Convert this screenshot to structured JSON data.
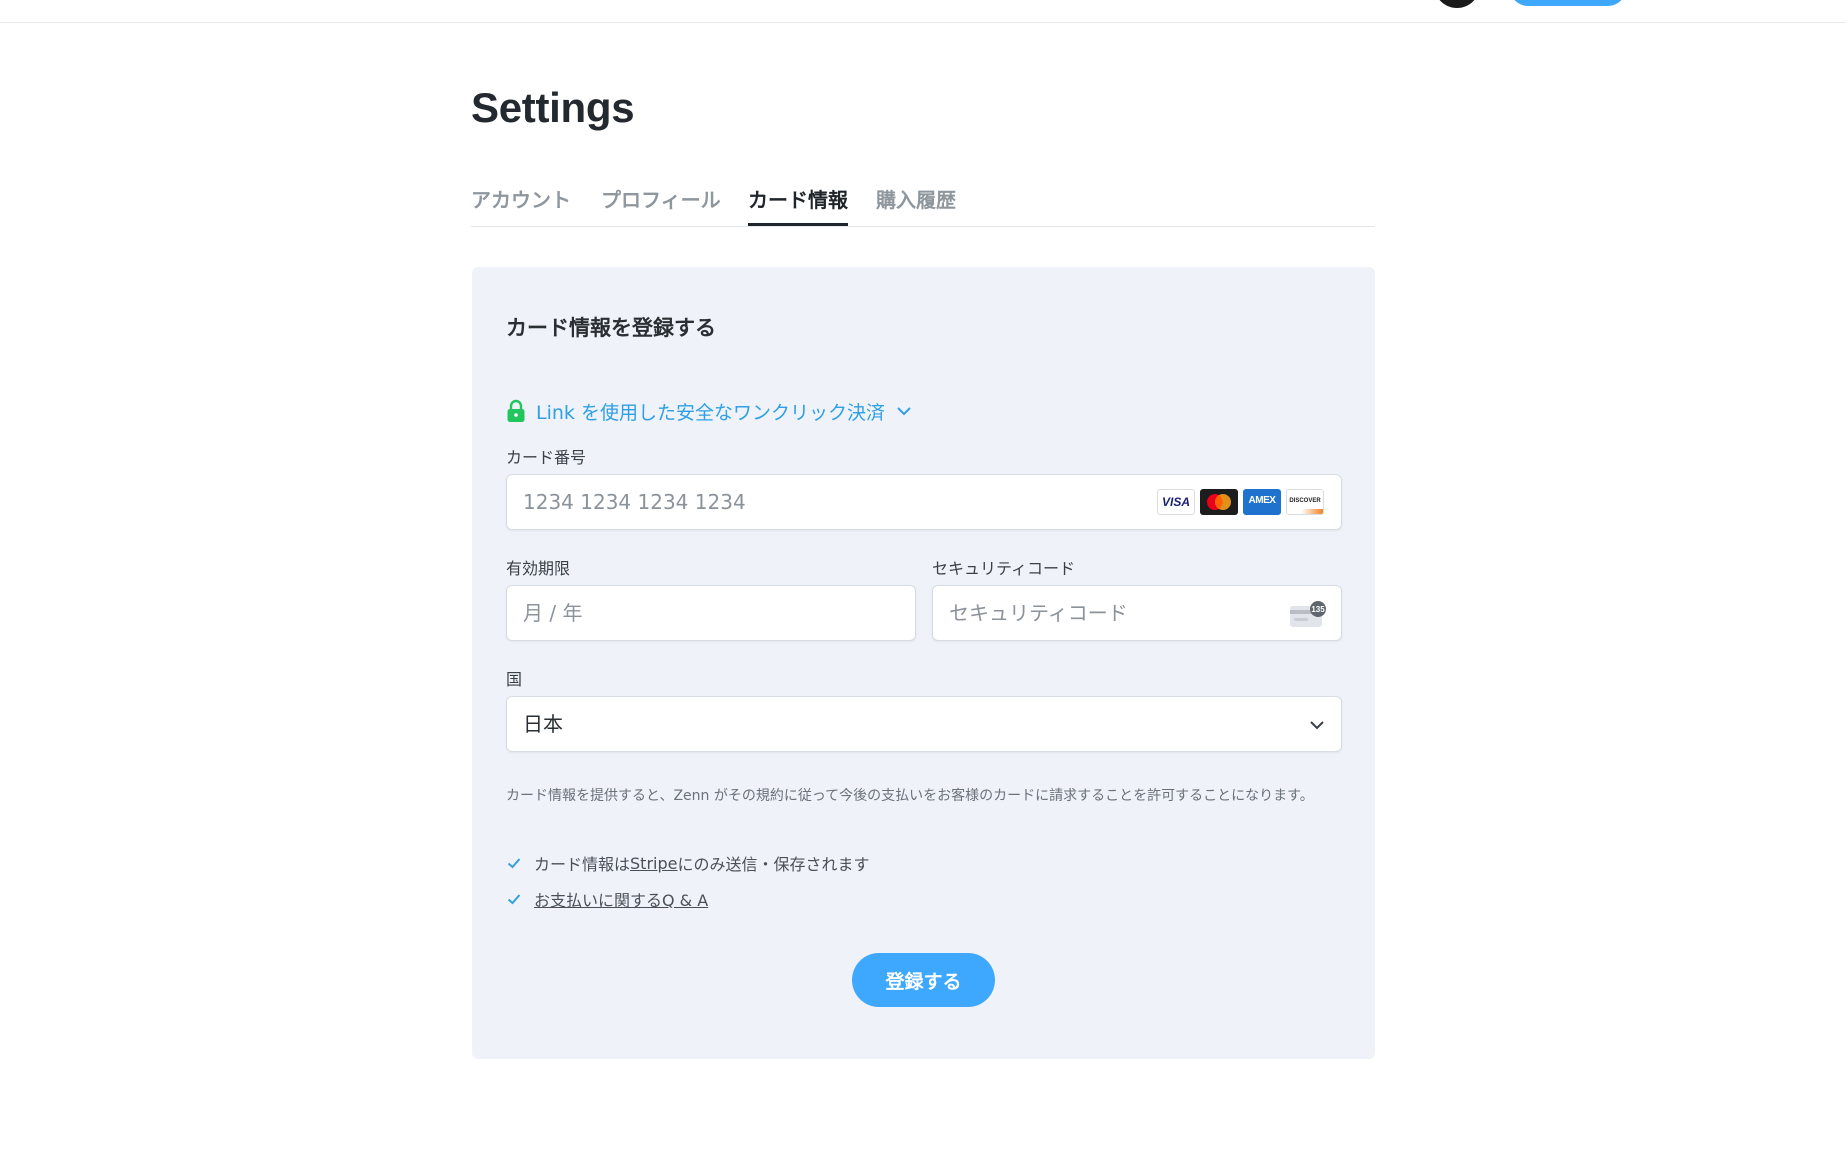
{
  "page": {
    "title": "Settings"
  },
  "tabs": [
    {
      "label": "アカウント",
      "active": false
    },
    {
      "label": "プロフィール",
      "active": false
    },
    {
      "label": "カード情報",
      "active": true
    },
    {
      "label": "購入履歴",
      "active": false
    }
  ],
  "card_form": {
    "heading": "カード情報を登録する",
    "link_text": "Link を使用した安全なワンクリック決済",
    "card_number": {
      "label": "カード番号",
      "placeholder": "1234 1234 1234 1234",
      "brands": [
        "VISA",
        "Mastercard",
        "AMEX",
        "DISCOVER"
      ]
    },
    "expiry": {
      "label": "有効期限",
      "placeholder": "月 / 年"
    },
    "cvc": {
      "label": "セキュリティコード",
      "placeholder": "セキュリティコード",
      "icon_text": "135"
    },
    "country": {
      "label": "国",
      "value": "日本"
    },
    "consent_text": "カード情報を提供すると、Zenn がその規約に従って今後の支払いをお客様のカードに請求することを許可することになります。",
    "notes": {
      "stripe_prefix": "カード情報は",
      "stripe_link": "Stripe",
      "stripe_suffix": "にのみ送信・保存されます",
      "faq_link": "お支払いに関するQ & A"
    },
    "submit_label": "登録する"
  },
  "colors": {
    "accent": "#3ea8ff",
    "link": "#2f9fe6",
    "lock": "#22c55e",
    "panel_bg": "#eff3f9"
  }
}
